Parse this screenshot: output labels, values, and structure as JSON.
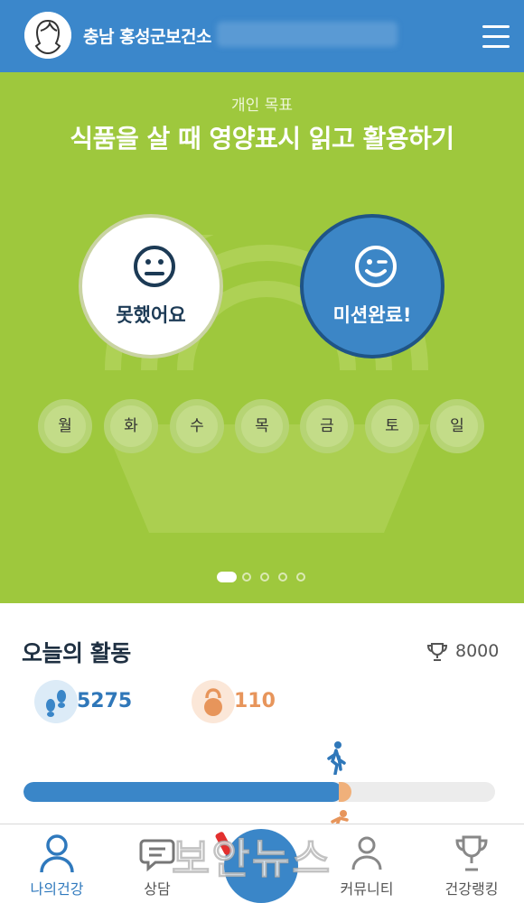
{
  "header": {
    "org_name": "충남 홍성군보건소",
    "avatar_icon": "user-avatar-icon",
    "menu_icon": "hamburger-menu-icon"
  },
  "goal": {
    "label": "개인 목표",
    "title": "식품을 살 때 영양표시 읽고 활용하기",
    "fail_button": {
      "label": "못했어요",
      "icon": "neutral-face-icon"
    },
    "done_button": {
      "label": "미션완료!",
      "icon": "wink-face-icon"
    },
    "days": [
      "월",
      "화",
      "수",
      "목",
      "금",
      "토",
      "일"
    ],
    "pagination": {
      "total": 5,
      "active": 1
    }
  },
  "activity": {
    "title": "오늘의 활동",
    "target_steps": "8000",
    "steps": "5275",
    "calories": "110",
    "progress_fraction": 0.676,
    "step_color": "#3a86c8",
    "calorie_color": "#e7955b"
  },
  "nav": {
    "items": [
      {
        "label": "나의건강",
        "icon": "person-icon",
        "active": true
      },
      {
        "label": "상담",
        "icon": "chat-bubble-icon",
        "active": false
      },
      {
        "label": "",
        "icon": "center-action-icon",
        "active": false
      },
      {
        "label": "커뮤니티",
        "icon": "community-icon",
        "active": false
      },
      {
        "label": "건강랭킹",
        "icon": "trophy-icon",
        "active": false
      }
    ]
  },
  "watermark": "보안뉴스"
}
